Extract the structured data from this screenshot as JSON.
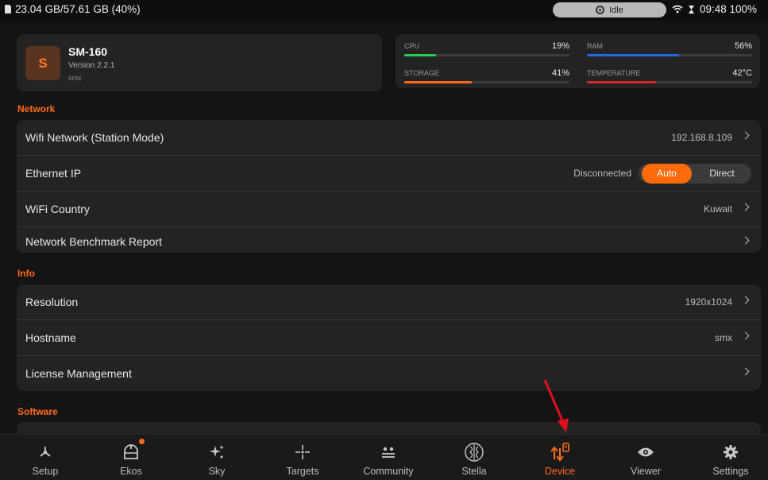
{
  "status_bar": {
    "storage_text": "23.04 GB/57.61 GB (40%)",
    "state": "Idle",
    "time_battery": "09:48 100%"
  },
  "device": {
    "initial": "S",
    "name": "SM-160",
    "version": "Version 2.2.1",
    "host": "smx"
  },
  "stats": [
    {
      "label": "CPU",
      "value": "19%",
      "level": 0.19,
      "color": "#25d05a"
    },
    {
      "label": "RAM",
      "value": "56%",
      "level": 0.56,
      "color": "#1e6ce0"
    },
    {
      "label": "STORAGE",
      "value": "41%",
      "level": 0.41,
      "color": "#ff6a1a"
    },
    {
      "label": "TEMPERATURE",
      "value": "42°C",
      "level": 0.42,
      "color": "#d62828"
    }
  ],
  "network": {
    "title": "Network",
    "wifi": {
      "label": "Wifi Network (Station Mode)",
      "value": "192.168.8.109"
    },
    "ethernet": {
      "label": "Ethernet IP",
      "status": "Disconnected",
      "options": [
        "Auto",
        "Direct"
      ],
      "selected": "Auto"
    },
    "country": {
      "label": "WiFi Country",
      "value": "Kuwait"
    },
    "benchmark": {
      "label": "Network Benchmark Report"
    }
  },
  "info": {
    "title": "Info",
    "resolution": {
      "label": "Resolution",
      "value": "1920x1024"
    },
    "hostname": {
      "label": "Hostname",
      "value": "smx"
    },
    "license": {
      "label": "License Management"
    }
  },
  "software": {
    "title": "Software"
  },
  "nav": {
    "items": [
      {
        "label": "Setup",
        "icon": "setup-icon"
      },
      {
        "label": "Ekos",
        "icon": "ekos-icon"
      },
      {
        "label": "Sky",
        "icon": "sky-icon"
      },
      {
        "label": "Targets",
        "icon": "targets-icon"
      },
      {
        "label": "Community",
        "icon": "community-icon"
      },
      {
        "label": "Stella",
        "icon": "stella-icon"
      },
      {
        "label": "Device",
        "icon": "device-icon"
      },
      {
        "label": "Viewer",
        "icon": "viewer-icon"
      },
      {
        "label": "Settings",
        "icon": "gear-icon"
      }
    ],
    "active": "Device"
  },
  "colors": {
    "accent": "#ff6a1a",
    "annotation": "#e0101c"
  }
}
